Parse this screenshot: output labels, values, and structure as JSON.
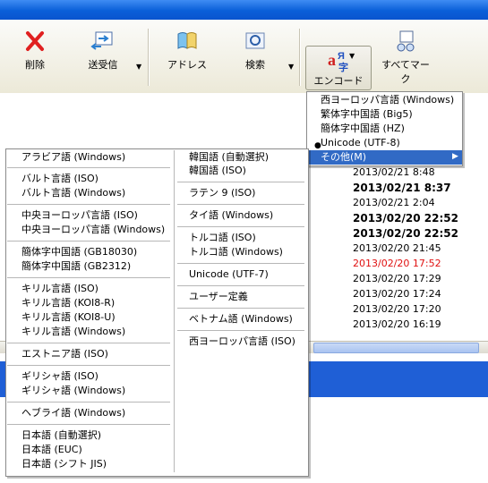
{
  "toolbar": {
    "delete": "削除",
    "send_receive": "送受信",
    "address": "アドレス",
    "search": "検索",
    "encode": "エンコード",
    "mark_all": "すべてマーク"
  },
  "encode_menu": {
    "items": [
      "西ヨーロッパ言語 (Windows)",
      "繁体字中国語 (Big5)",
      "簡体字中国語 (HZ)",
      "Unicode (UTF-8)"
    ],
    "other": "その他(M)"
  },
  "sub_menu": {
    "left": [
      "アラビア語 (Windows)",
      "バルト言語 (ISO)",
      "バルト言語 (Windows)",
      "中央ヨーロッパ言語 (ISO)",
      "中央ヨーロッパ言語 (Windows)",
      "簡体字中国語 (GB18030)",
      "簡体字中国語 (GB2312)",
      "キリル言語 (ISO)",
      "キリル言語 (KOI8-R)",
      "キリル言語 (KOI8-U)",
      "キリル言語 (Windows)",
      "エストニア語 (ISO)",
      "ギリシャ語 (ISO)",
      "ギリシャ語 (Windows)",
      "ヘブライ語 (Windows)",
      "日本語 (自動選択)",
      "日本語 (EUC)",
      "日本語 (シフト JIS)"
    ],
    "right": [
      "韓国語 (自動選択)",
      "韓国語 (ISO)",
      "ラテン 9 (ISO)",
      "タイ語 (Windows)",
      "トルコ語 (ISO)",
      "トルコ語 (Windows)",
      "Unicode (UTF-7)",
      "ユーザー定義",
      "ベトナム語 (Windows)",
      "西ヨーロッパ言語 (ISO)"
    ]
  },
  "mail_list": {
    "dates": [
      "2013/02/21 8:48",
      "2013/02/21 8:37",
      "2013/02/21 2:04",
      "2013/02/20 22:52",
      "2013/02/20 22:52",
      "2013/02/20 21:45",
      "2013/02/20 17:52",
      "2013/02/20 17:29",
      "2013/02/20 17:24",
      "2013/02/20 17:20",
      "2013/02/20 16:19"
    ]
  },
  "colors": {
    "menu_highlight": "#316ac5",
    "unread_red": "#e01010",
    "panel_blue": "#1f5fd6"
  }
}
